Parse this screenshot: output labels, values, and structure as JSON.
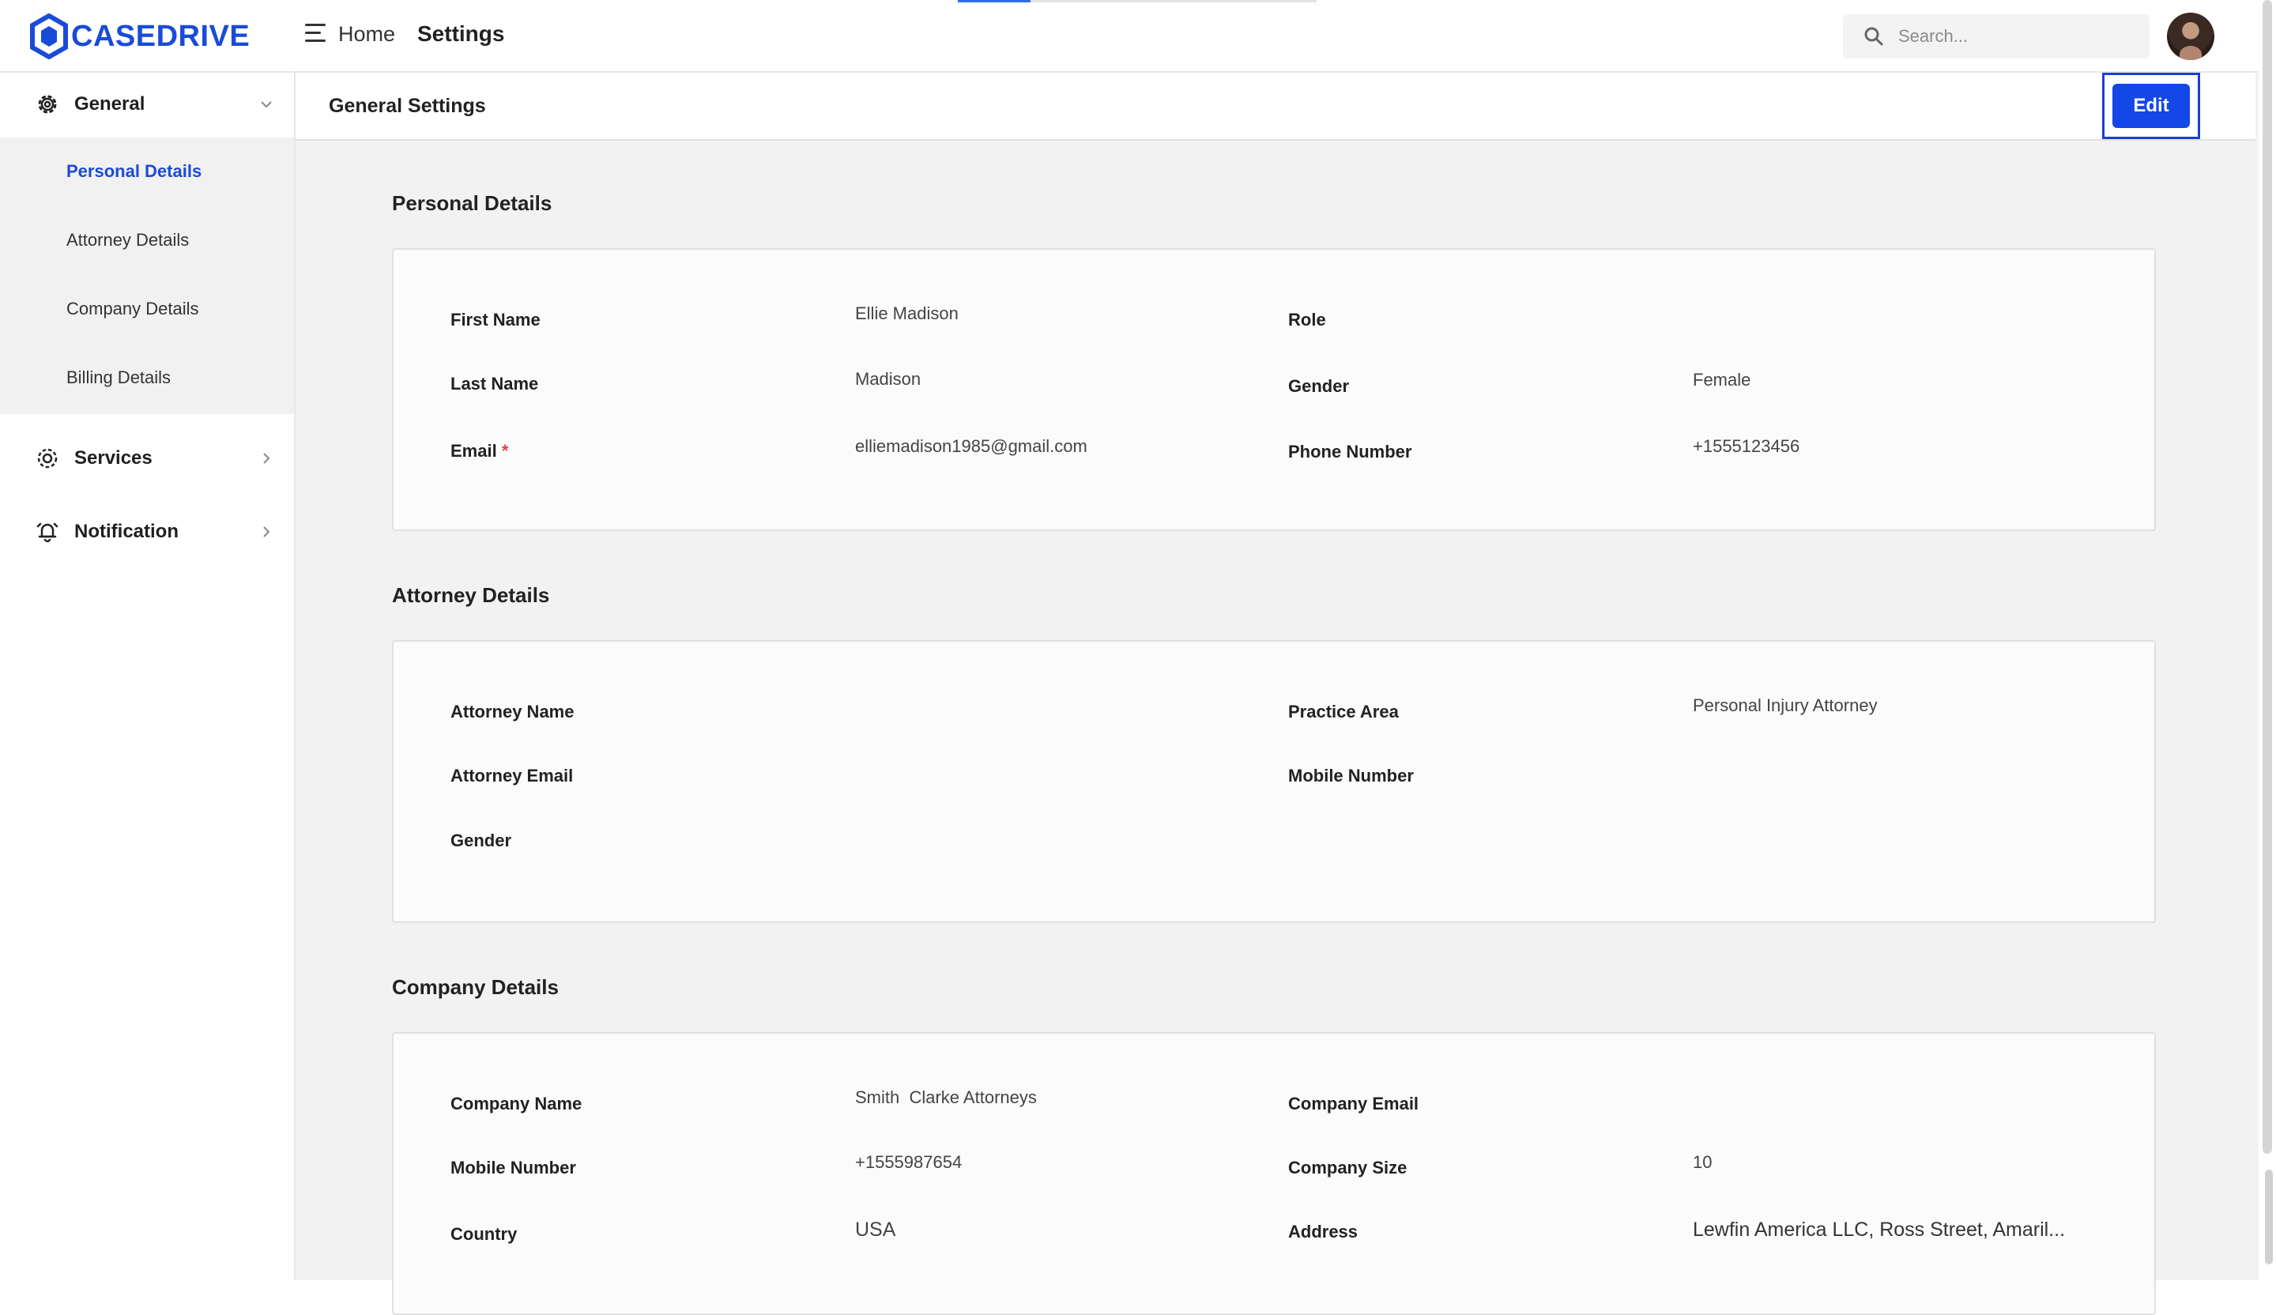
{
  "app": {
    "logo_text": "CASEDRIVE",
    "brand_color": "#1a4bd8"
  },
  "topbar": {
    "breadcrumb_home": "Home",
    "breadcrumb_current": "Settings",
    "search_placeholder": "Search..."
  },
  "sidebar": {
    "general": {
      "label": "General",
      "icon": "gear-icon"
    },
    "sub_items": [
      {
        "label": "Personal Details",
        "active": true
      },
      {
        "label": "Attorney Details",
        "active": false
      },
      {
        "label": "Company Details",
        "active": false
      },
      {
        "label": "Billing Details",
        "active": false
      }
    ],
    "services": {
      "label": "Services",
      "icon": "settings-cog-icon"
    },
    "notification": {
      "label": "Notification",
      "icon": "bell-icon"
    }
  },
  "page": {
    "title": "General Settings",
    "edit_label": "Edit"
  },
  "personal": {
    "title": "Personal Details",
    "first_name_label": "First Name",
    "first_name": "Ellie Madison",
    "role_label": "Role",
    "role": "",
    "last_name_label": "Last Name",
    "last_name": "Madison",
    "gender_label": "Gender",
    "gender": "Female",
    "email_label": "Email",
    "email_required": "*",
    "email": "elliemadison1985@gmail.com",
    "phone_label": "Phone Number",
    "phone": "+1555123456"
  },
  "attorney": {
    "title": "Attorney Details",
    "name_label": "Attorney Name",
    "name": "",
    "practice_label": "Practice Area",
    "practice": "Personal Injury Attorney",
    "email_label": "Attorney Email",
    "email": "",
    "mobile_label": "Mobile Number",
    "mobile": "",
    "gender_label": "Gender",
    "gender": ""
  },
  "company": {
    "title": "Company Details",
    "name_label": "Company Name",
    "name": "Smith  Clarke Attorneys",
    "email_label": "Company Email",
    "email": "",
    "mobile_label": "Mobile Number",
    "mobile": "+1555987654",
    "size_label": "Company Size",
    "size": "10",
    "country_label": "Country",
    "country": "USA",
    "address_label": "Address",
    "address": "Lewfin America LLC, Ross Street, Amaril..."
  }
}
